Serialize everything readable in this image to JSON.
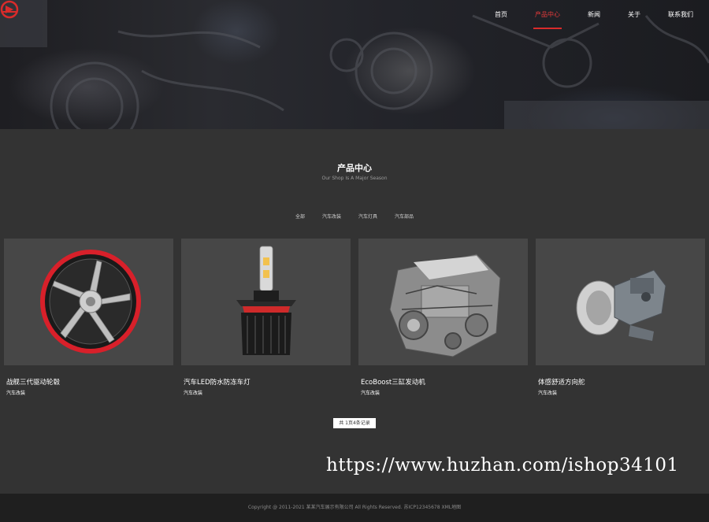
{
  "nav": {
    "items": [
      {
        "label": "首页",
        "active": false
      },
      {
        "label": "产品中心",
        "active": true
      },
      {
        "label": "新闻",
        "active": false
      },
      {
        "label": "关于",
        "active": false
      },
      {
        "label": "联系我们",
        "active": false
      }
    ]
  },
  "section": {
    "title": "产品中心",
    "subtitle": "Our Shop Is A Major Season"
  },
  "filters": [
    "全部",
    "汽车改装",
    "汽车灯具",
    "汽车部品"
  ],
  "products": [
    {
      "title": "战舰三代驱动轮毂",
      "category": "汽车改装",
      "image": "wheel-rim"
    },
    {
      "title": "汽车LED防水防冻车灯",
      "category": "汽车改装",
      "image": "led-bulb"
    },
    {
      "title": "EcoBoost三缸发动机",
      "category": "汽车改装",
      "image": "engine"
    },
    {
      "title": "体感舒适方向舵",
      "category": "汽车改装",
      "image": "brake-part"
    }
  ],
  "pager": {
    "text": "共 1页4条记录"
  },
  "watermark": "https://www.huzhan.com/ishop34101",
  "footer": {
    "text": "Copyright @ 2011-2021 某某汽车展示有限公司 All Rights Reserved.   苏ICP12345678  XML地图"
  },
  "colors": {
    "accent": "#d92b2b",
    "background": "#333333",
    "card": "#474747",
    "footer": "#1f1f1f"
  }
}
